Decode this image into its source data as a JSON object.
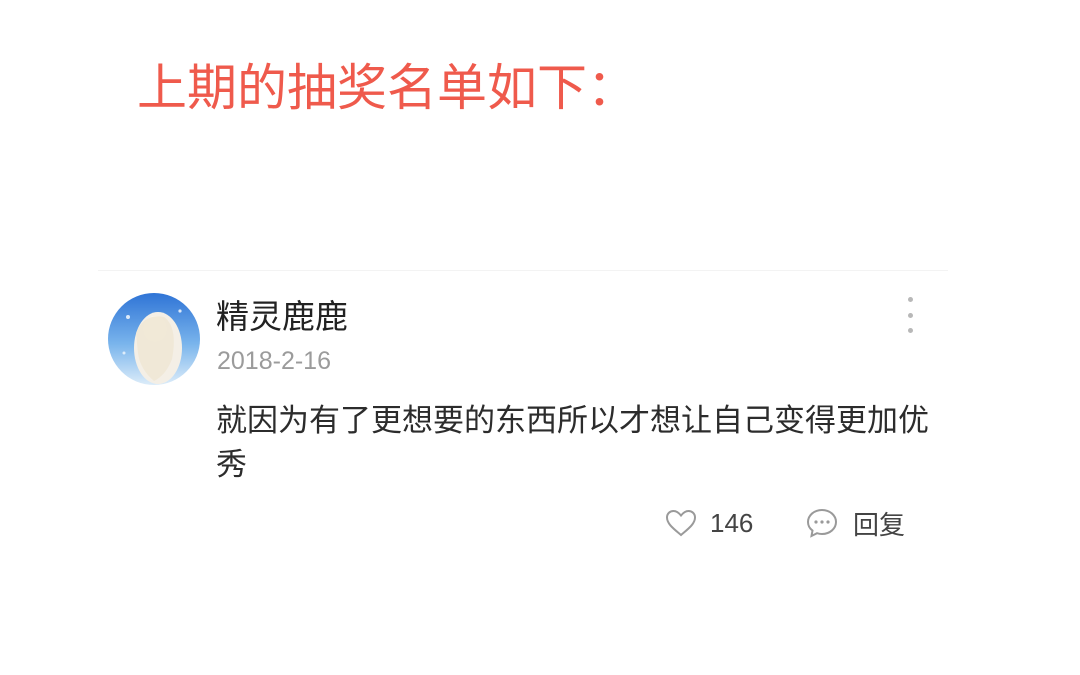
{
  "headline": "上期的抽奖名单如下：",
  "comment": {
    "username": "精灵鹿鹿",
    "date": "2018-2-16",
    "text": "就因为有了更想要的东西所以才想让自己变得更加优秀",
    "like_count": "146",
    "reply_label": "回复"
  },
  "icons": {
    "like": "heart-outline-icon",
    "reply": "speech-bubble-icon",
    "more": "vertical-ellipsis-icon"
  },
  "colors": {
    "headline": "#ef5a4c",
    "muted_text": "#9b9b9b",
    "body_text": "#2c2c2c"
  }
}
